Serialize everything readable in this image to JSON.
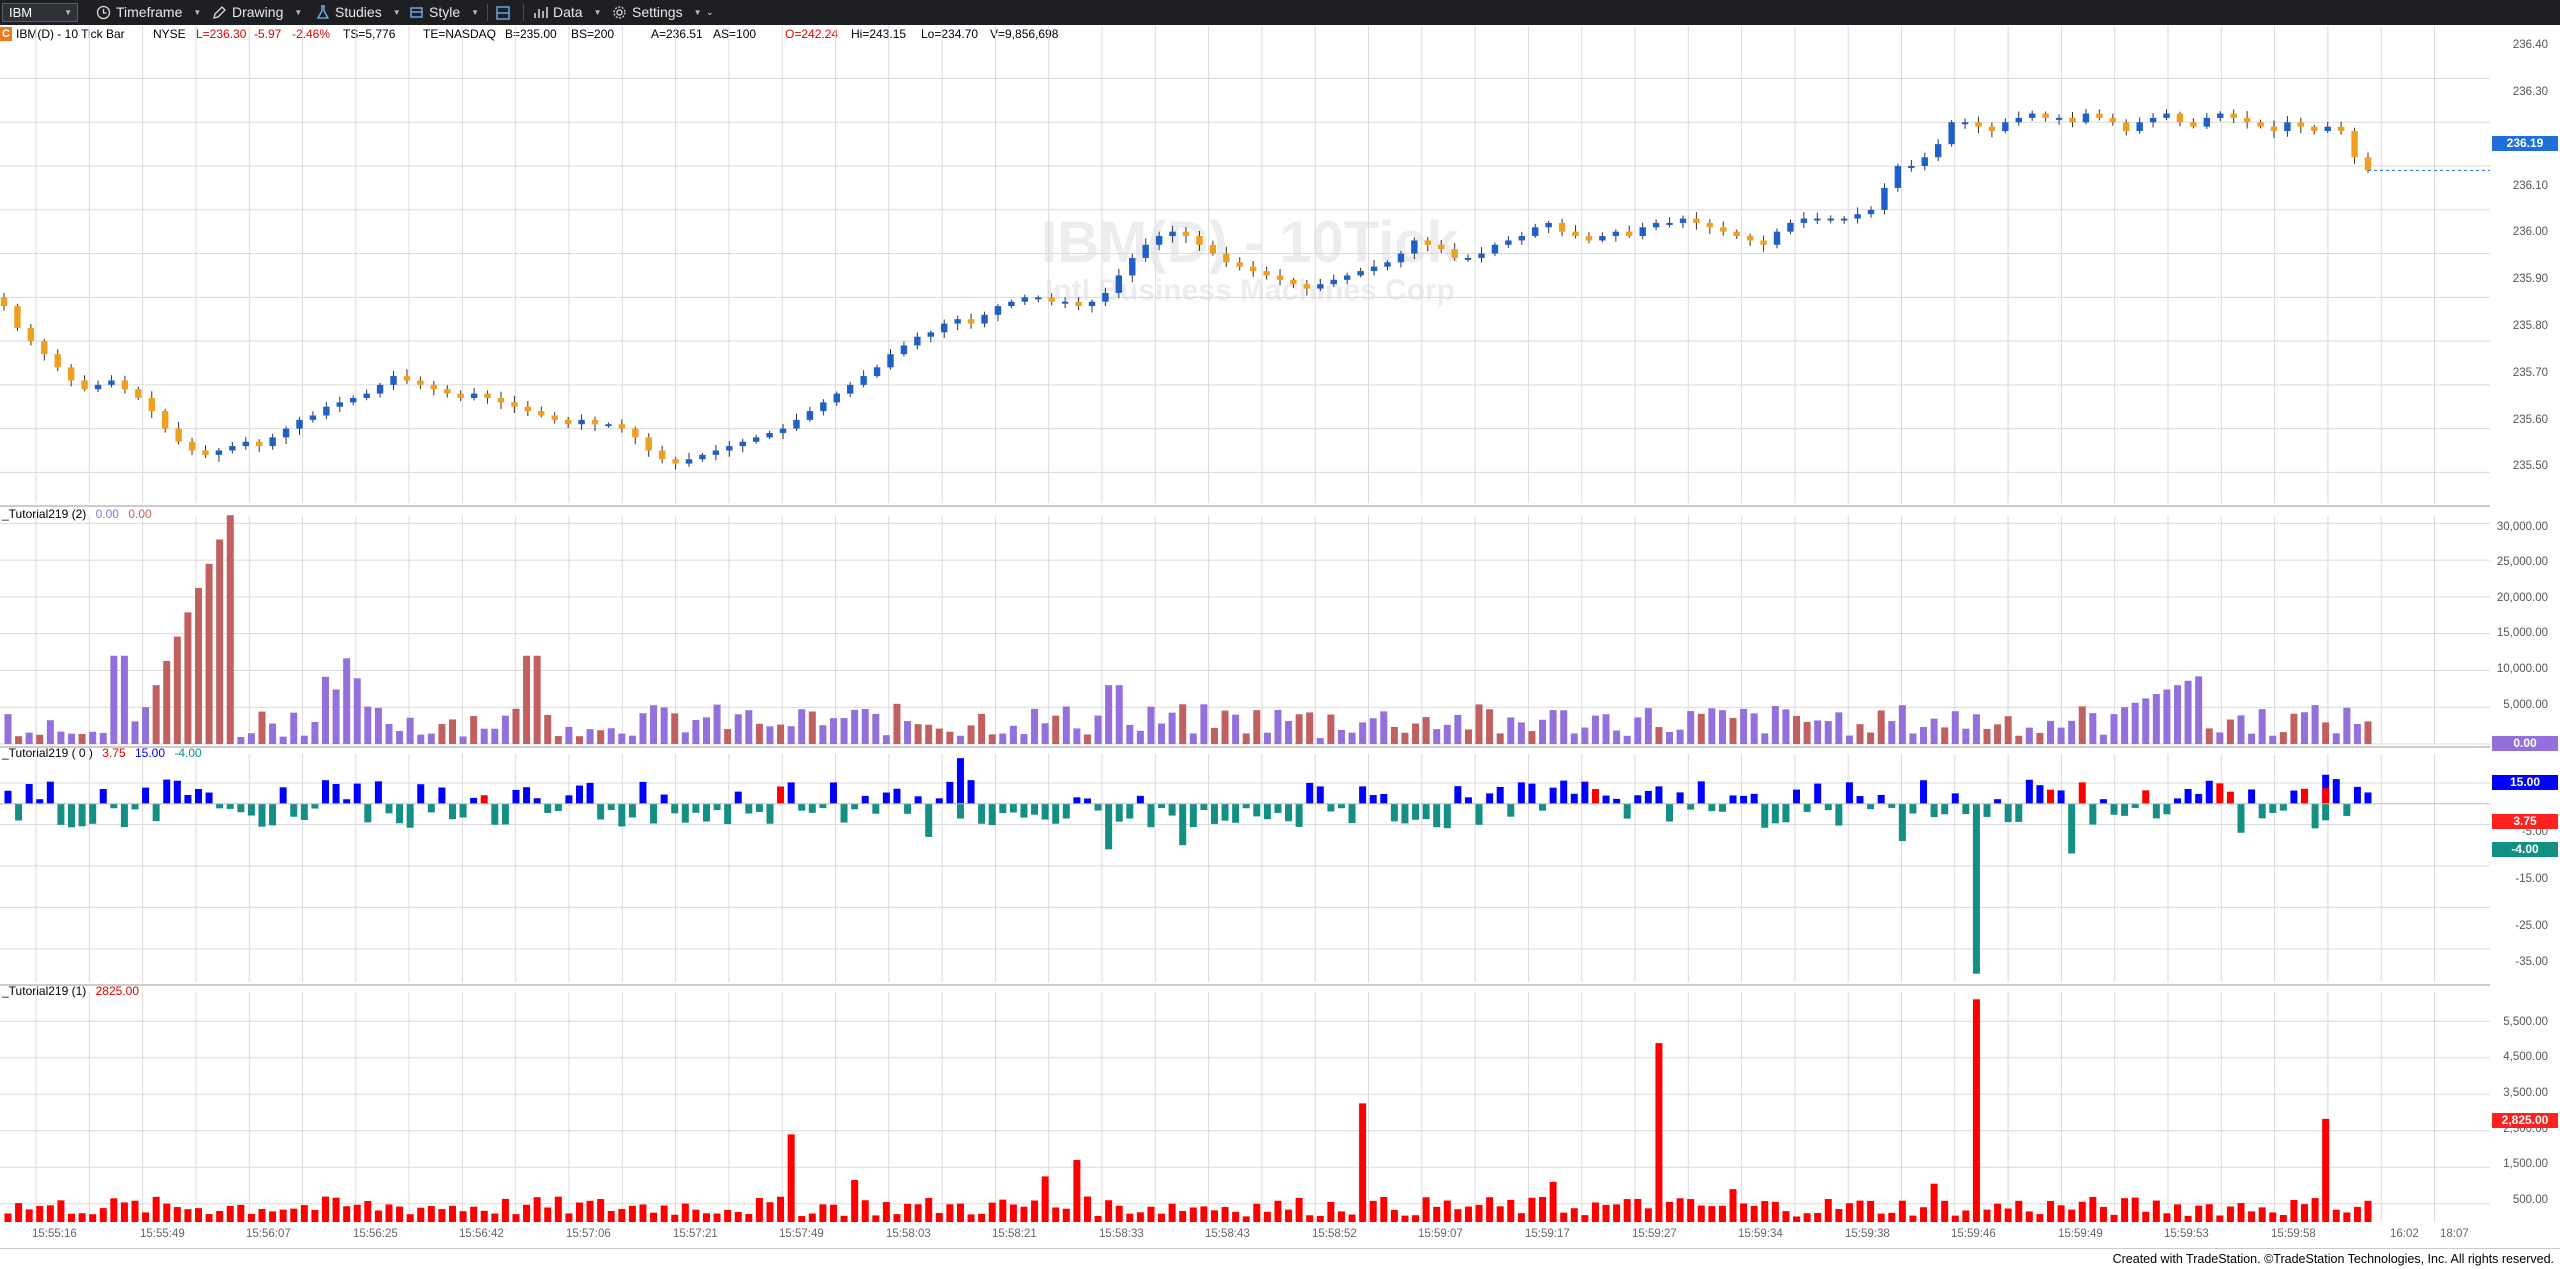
{
  "toolbar": {
    "symbol": "IBM",
    "timeframe_label": "Timeframe",
    "drawing_label": "Drawing",
    "studies_label": "Studies",
    "style_label": "Style",
    "data_label": "Data",
    "settings_label": "Settings",
    "icons": [
      "clock-icon",
      "pencil-icon",
      "flask-icon",
      "style-icon",
      "layout-icon",
      "data-icon",
      "gear-icon"
    ]
  },
  "status": {
    "c_badge": "C",
    "symbol_desc": "IBM(D) - 10 Tick Bar",
    "exchange": "NYSE",
    "last": "L=236.30",
    "net_change": "-5.97",
    "pct_change": "-2.46%",
    "trade_size": "TS=5,776",
    "trade_exchange": "TE=NASDAQ",
    "bid": "B=235.00",
    "bid_size": "BS=200",
    "ask": "A=236.51",
    "ask_size": "AS=100",
    "open": "O=242.24",
    "high": "Hi=243.15",
    "low": "Lo=234.70",
    "volume": "V=9,856,698"
  },
  "watermark": {
    "line1": "IBM(D) - 10Tick",
    "line2": "Intl Business Machines Corp"
  },
  "panels": {
    "panel2_name": "_Tutorial219 (2)",
    "panel2_v1": "0.00",
    "panel2_v2": "0.00",
    "panel3_name": "_Tutorial219 ( 0 )",
    "panel3_v1": "3.75",
    "panel3_v2": "15.00",
    "panel3_v3": "-4.00",
    "panel4_name": "_Tutorial219 (1)",
    "panel4_v1": "2825.00"
  },
  "price_axis": {
    "labels": [
      "236.40",
      "236.30",
      "236.10",
      "236.00",
      "235.90",
      "235.80",
      "235.70",
      "235.60",
      "235.50"
    ],
    "last_marker": "236.19"
  },
  "panel2_axis": {
    "labels": [
      "30,000.00",
      "25,000.00",
      "20,000.00",
      "15,000.00",
      "10,000.00",
      "5,000.00"
    ],
    "marker": "0.00"
  },
  "panel3_axis": {
    "labels": [
      "5.00",
      "-5.00",
      "-15.00",
      "-25.00",
      "-35.00"
    ],
    "marker_blue": "15.00",
    "marker_red": "3.75",
    "marker_teal": "-4.00"
  },
  "panel4_axis": {
    "labels": [
      "5,500.00",
      "4,500.00",
      "3,500.00",
      "2,500.00",
      "1,500.00",
      "500.00"
    ],
    "marker": "2,825.00"
  },
  "time_axis": {
    "labels": [
      "15:55:16",
      "15:55:49",
      "15:56:07",
      "15:56:25",
      "15:56:42",
      "15:57:06",
      "15:57:21",
      "15:57:49",
      "15:58:03",
      "15:58:21",
      "15:58:33",
      "15:58:43",
      "15:58:52",
      "15:59:07",
      "15:59:17",
      "15:59:27",
      "15:59:34",
      "15:59:38",
      "15:59:46",
      "15:59:49",
      "15:59:53",
      "15:59:58",
      "16:02",
      "18:07"
    ]
  },
  "footer": {
    "text": "Created with TradeStation. ©TradeStation Technologies, Inc. All rights reserved."
  },
  "colors": {
    "up_bar": "#1e5fc8",
    "down_bar": "#f0a020",
    "purple": "#9370db",
    "indian_red": "#c06060",
    "blue": "#0000ff",
    "red": "#ff0000",
    "teal": "#138f84"
  },
  "chart_data": [
    {
      "type": "candlestick",
      "title": "IBM(D) - 10 Tick Bar",
      "ylim": [
        235.43,
        236.52
      ],
      "series": [
        {
          "name": "price",
          "close": [
            235.88,
            235.83,
            235.8,
            235.77,
            235.74,
            235.71,
            235.69,
            235.7,
            235.71,
            235.69,
            235.67,
            235.64,
            235.6,
            235.57,
            235.55,
            235.54,
            235.55,
            235.56,
            235.57,
            235.56,
            235.58,
            235.6,
            235.62,
            235.63,
            235.65,
            235.66,
            235.67,
            235.68,
            235.7,
            235.72,
            235.71,
            235.7,
            235.69,
            235.68,
            235.67,
            235.68,
            235.67,
            235.66,
            235.65,
            235.64,
            235.63,
            235.62,
            235.61,
            235.62,
            235.61,
            235.61,
            235.6,
            235.58,
            235.55,
            235.53,
            235.52,
            235.53,
            235.54,
            235.55,
            235.56,
            235.57,
            235.58,
            235.59,
            235.6,
            235.62,
            235.64,
            235.66,
            235.68,
            235.7,
            235.72,
            235.74,
            235.77,
            235.79,
            235.81,
            235.82,
            235.84,
            235.85,
            235.84,
            235.86,
            235.88,
            235.89,
            235.9,
            235.9,
            235.89,
            235.89,
            235.88,
            235.89,
            235.91,
            235.95,
            235.99,
            236.02,
            236.04,
            236.05,
            236.04,
            236.02,
            236.0,
            235.98,
            235.97,
            235.96,
            235.95,
            235.94,
            235.93,
            235.92,
            235.93,
            235.94,
            235.95,
            235.96,
            235.97,
            235.98,
            236.0,
            236.03,
            236.02,
            236.01,
            235.99,
            235.99,
            236.0,
            236.02,
            236.03,
            236.04,
            236.06,
            236.07,
            236.05,
            236.04,
            236.03,
            236.04,
            236.05,
            236.04,
            236.06,
            236.07,
            236.07,
            236.08,
            236.07,
            236.06,
            236.05,
            236.04,
            236.03,
            236.02,
            236.05,
            236.07,
            236.08,
            236.08,
            236.08,
            236.08,
            236.09,
            236.1,
            236.15,
            236.2,
            236.2,
            236.22,
            236.25,
            236.3,
            236.3,
            236.29,
            236.28,
            236.3,
            236.31,
            236.32,
            236.31,
            236.31,
            236.3,
            236.32,
            236.31,
            236.3,
            236.28,
            236.3,
            236.31,
            236.32,
            236.3,
            236.29,
            236.31,
            236.32,
            236.31,
            236.3,
            236.29,
            236.28,
            236.3,
            236.29,
            236.28,
            236.29,
            236.28,
            236.22,
            236.19
          ]
        }
      ]
    },
    {
      "type": "bar",
      "title": "_Tutorial219 (2)",
      "ylim": [
        0,
        31000
      ],
      "series": [
        {
          "name": "purple",
          "values": []
        },
        {
          "name": "red",
          "values": []
        }
      ]
    },
    {
      "type": "bar",
      "title": "_Tutorial219 ( 0 )",
      "ylim": [
        -43,
        12
      ],
      "series": [
        {
          "name": "blue",
          "values": []
        },
        {
          "name": "red",
          "values": []
        },
        {
          "name": "teal",
          "values": []
        }
      ]
    },
    {
      "type": "bar",
      "title": "_Tutorial219 (1)",
      "ylim": [
        0,
        6300
      ],
      "series": [
        {
          "name": "red",
          "values": []
        }
      ]
    }
  ]
}
